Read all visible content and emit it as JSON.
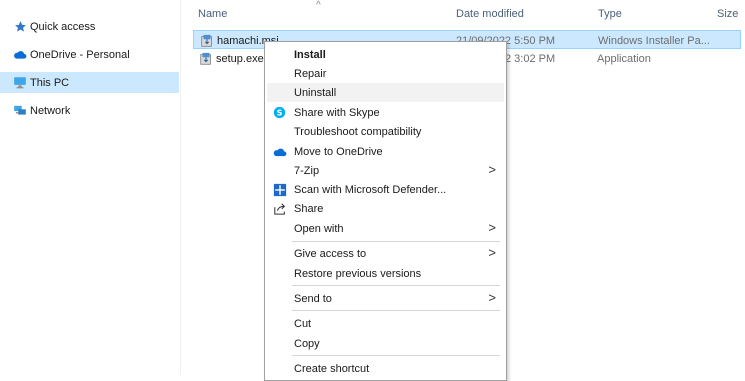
{
  "nav": {
    "items": [
      {
        "label": "Quick access",
        "icon": "star-icon"
      },
      {
        "label": "OneDrive - Personal",
        "icon": "cloud-icon"
      },
      {
        "label": "This PC",
        "icon": "computer-icon"
      },
      {
        "label": "Network",
        "icon": "network-icon"
      }
    ]
  },
  "columns": {
    "name": "Name",
    "date": "Date modified",
    "type": "Type",
    "size": "Size",
    "sort_indicator": "^"
  },
  "files": [
    {
      "name": "hamachi.msi",
      "date": "21/09/2022 5:50 PM",
      "type": "Windows Installer Pa..."
    },
    {
      "name": "setup.exe",
      "date": "2 3:02 PM",
      "type": "Application"
    }
  ],
  "context_menu": {
    "items": [
      {
        "label": "Install",
        "bold": true
      },
      {
        "label": "Repair"
      },
      {
        "label": "Uninstall",
        "hover": true
      },
      {
        "label": "Share with Skype",
        "icon": "skype-icon"
      },
      {
        "label": "Troubleshoot compatibility"
      },
      {
        "label": "Move to OneDrive",
        "icon": "onedrive-icon"
      },
      {
        "label": "7-Zip",
        "submenu": true
      },
      {
        "label": "Scan with Microsoft Defender...",
        "icon": "defender-icon"
      },
      {
        "label": "Share",
        "icon": "share-icon"
      },
      {
        "label": "Open with",
        "submenu": true
      },
      {
        "label": "Give access to",
        "submenu": true
      },
      {
        "label": "Restore previous versions"
      },
      {
        "label": "Send to",
        "submenu": true
      },
      {
        "label": "Cut"
      },
      {
        "label": "Copy"
      },
      {
        "label": "Create shortcut"
      }
    ],
    "submenu_glyph": ">"
  },
  "colors": {
    "selection": "#cce8ff",
    "selection_border": "#99d1ff",
    "header_text": "#4c607a",
    "skype": "#00aff0",
    "onedrive": "#0a6cd6"
  }
}
